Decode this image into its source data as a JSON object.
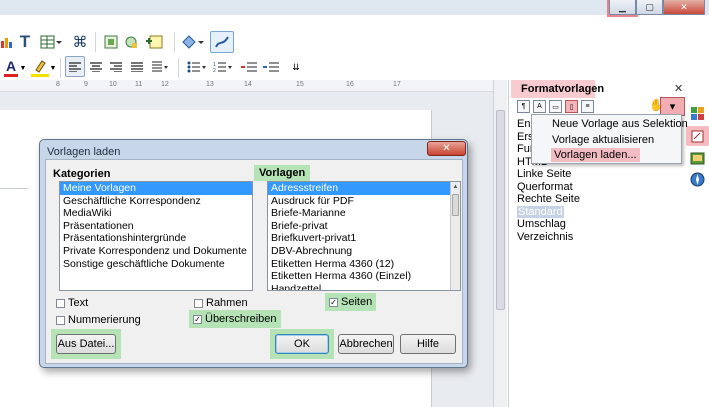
{
  "window": {
    "minimize_glyph": "▁",
    "maximize_glyph": "▢",
    "close_glyph": "✕"
  },
  "toolbar": {
    "icons": [
      "bar-chart-icon",
      "text-T-icon",
      "table-icon",
      "navigator-icon",
      "frame-icon",
      "image-icon",
      "note-icon",
      "shapes-icon",
      "draw-icon"
    ],
    "format_icons": [
      "font-color-icon",
      "highlight-icon",
      "align-left-icon",
      "align-center-icon",
      "align-right-icon",
      "justify-icon",
      "bullets-icon",
      "numbering-icon",
      "indent-increase-icon",
      "indent-decrease-icon",
      "paragraph-style-icon"
    ],
    "text_T": "T",
    "font_color_glyph": "A",
    "paragraph_glyph": "¶"
  },
  "ruler": {
    "marks": [
      "8",
      "9",
      "10",
      "11",
      "12",
      "13",
      "14",
      "15",
      "16",
      "17"
    ]
  },
  "sidebar": {
    "title": "Formatvorlagen",
    "close_glyph": "✕",
    "styles": [
      "Ende",
      "Erst",
      "Fuß",
      "HTML",
      "Linke Seite",
      "Querformat",
      "Rechte Seite",
      "Standard",
      "Umschlag",
      "Verzeichnis"
    ],
    "selected_style": "Standard"
  },
  "context_menu": {
    "items": [
      "Neue Vorlage aus Selektion",
      "Vorlage aktualisieren",
      "Vorlagen laden..."
    ],
    "highlighted": "Vorlagen laden..."
  },
  "dialog": {
    "title": "Vorlagen laden",
    "close_glyph": "✕",
    "categories_label": "Kategorien",
    "categories": [
      "Meine Vorlagen",
      "Geschäftliche Korrespondenz",
      "MediaWiki",
      "Präsentationen",
      "Präsentationshintergründe",
      "Private Korrespondenz und Dokumente",
      "Sonstige geschäftliche Dokumente"
    ],
    "selected_category": "Meine Vorlagen",
    "templates_label": "Vorlagen",
    "templates": [
      "Adressstreifen",
      "Ausdruck für PDF",
      "Briefe-Marianne",
      "Briefe-privat",
      "Briefkuvert-privat1",
      "DBV-Abrechnung",
      "Etiketten Herma 4360 (12)",
      "Etiketten Herma 4360 (Einzel)",
      "Handzettel"
    ],
    "selected_template": "Adressstreifen",
    "options": {
      "text": {
        "label": "Text",
        "checked": false
      },
      "rahmen": {
        "label": "Rahmen",
        "checked": false
      },
      "seiten": {
        "label": "Seiten",
        "checked": true
      },
      "nummerierung": {
        "label": "Nummerierung",
        "checked": false
      },
      "ueberschreiben": {
        "label": "Überschreiben",
        "checked": true
      }
    },
    "buttons": {
      "from_file": "Aus Datei...",
      "ok": "OK",
      "cancel": "Abbrechen",
      "help": "Hilfe"
    },
    "check_glyph": "✓"
  }
}
